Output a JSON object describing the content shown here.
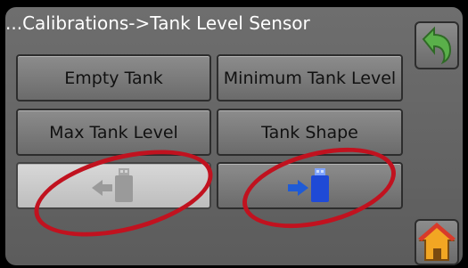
{
  "breadcrumb": "...Calibrations->Tank Level Sensor",
  "buttons": {
    "empty_tank": "Empty Tank",
    "min_tank_level": "Minimum Tank Level",
    "max_tank_level": "Max Tank Level",
    "tank_shape": "Tank Shape"
  },
  "icons": {
    "usb_export": "usb-export-icon",
    "usb_import": "usb-import-icon",
    "back": "back-arrow-icon",
    "home": "home-icon"
  },
  "colors": {
    "screen_bg": "#626262",
    "export_arrow": "#9a9a9a",
    "import_arrow": "#1f5bd6",
    "back_arrow": "#5ab04a",
    "annotation": "#c1121f"
  }
}
